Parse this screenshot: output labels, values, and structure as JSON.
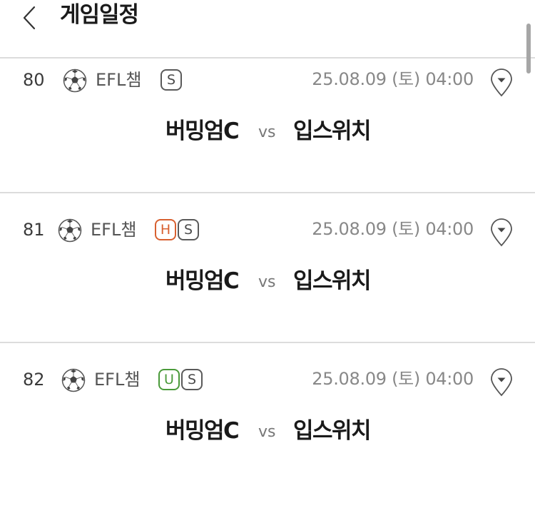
{
  "header": {
    "title": "게임일정",
    "back_icon": "chevron-left-icon"
  },
  "colors": {
    "badge_default": "#5a5a5a",
    "badge_h": "#d86030",
    "badge_u": "#4a9a3a",
    "divider": "#dcdcdc"
  },
  "matches": [
    {
      "number": "80",
      "league": "EFL챔",
      "badges": [
        "S"
      ],
      "datetime": "25.08.09 (토) 04:00",
      "home": "버밍엄C",
      "vs": "vs",
      "away": "입스위치"
    },
    {
      "number": "81",
      "league": "EFL챔",
      "badges": [
        "H",
        "S"
      ],
      "datetime": "25.08.09 (토) 04:00",
      "home": "버밍엄C",
      "vs": "vs",
      "away": "입스위치"
    },
    {
      "number": "82",
      "league": "EFL챔",
      "badges": [
        "U",
        "S"
      ],
      "datetime": "25.08.09 (토) 04:00",
      "home": "버밍엄C",
      "vs": "vs",
      "away": "입스위치"
    }
  ]
}
